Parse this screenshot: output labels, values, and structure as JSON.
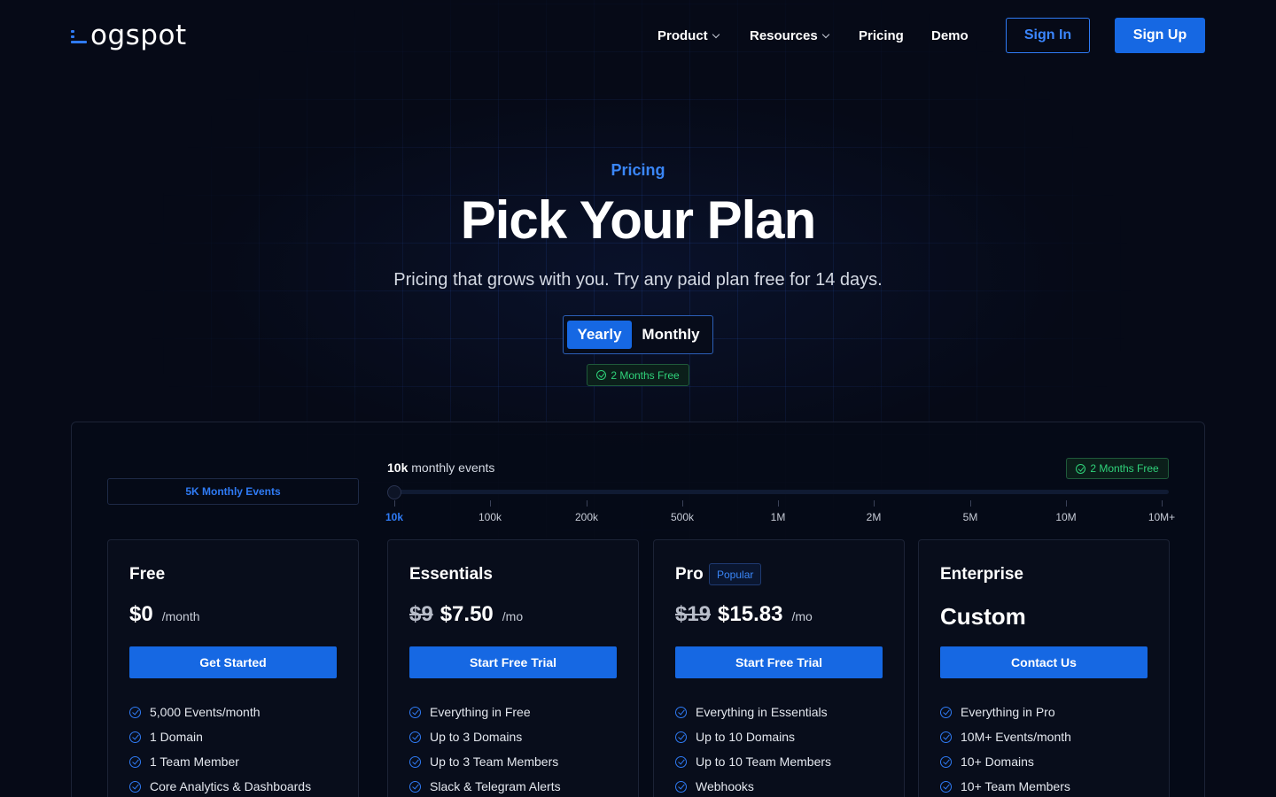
{
  "nav": {
    "logo_text": "ogspot",
    "product": "Product",
    "resources": "Resources",
    "pricing": "Pricing",
    "demo": "Demo",
    "sign_in": "Sign In",
    "sign_up": "Sign Up"
  },
  "hero": {
    "eyebrow": "Pricing",
    "title": "Pick Your Plan",
    "subtitle": "Pricing that grows with you. Try any paid plan free for 14 days.",
    "toggle": {
      "yearly": "Yearly",
      "monthly": "Monthly",
      "selected": "Yearly"
    },
    "badge": "2 Months Free"
  },
  "slider": {
    "events_box": "5K Monthly Events",
    "label_value": "10k",
    "label_text": "monthly events",
    "badge": "2 Months Free",
    "selected_index": 0,
    "ticks": [
      "10k",
      "100k",
      "200k",
      "500k",
      "1M",
      "2M",
      "5M",
      "10M",
      "10M+"
    ]
  },
  "plans": [
    {
      "name": "Free",
      "price": "$0",
      "unit": "/month",
      "button": "Get Started",
      "features": [
        "5,000 Events/month",
        "1 Domain",
        "1 Team Member",
        "Core Analytics & Dashboards"
      ]
    },
    {
      "name": "Essentials",
      "old_price": "$9",
      "price": "$7.50",
      "unit": "/mo",
      "button": "Start Free Trial",
      "features": [
        "Everything in Free",
        "Up to 3 Domains",
        "Up to 3 Team Members",
        "Slack & Telegram Alerts"
      ]
    },
    {
      "name": "Pro",
      "badge": "Popular",
      "old_price": "$19",
      "price": "$15.83",
      "unit": "/mo",
      "button": "Start Free Trial",
      "features": [
        "Everything in Essentials",
        "Up to 10 Domains",
        "Up to 10 Team Members",
        "Webhooks"
      ]
    },
    {
      "name": "Enterprise",
      "price": "Custom",
      "button": "Contact Us",
      "features": [
        "Everything in Pro",
        "10M+ Events/month",
        "10+ Domains",
        "10+ Team Members"
      ]
    }
  ],
  "colors": {
    "accent": "#1668e3",
    "accent_text": "#3a86f7",
    "success": "#2fd27a",
    "background": "#060a17"
  }
}
